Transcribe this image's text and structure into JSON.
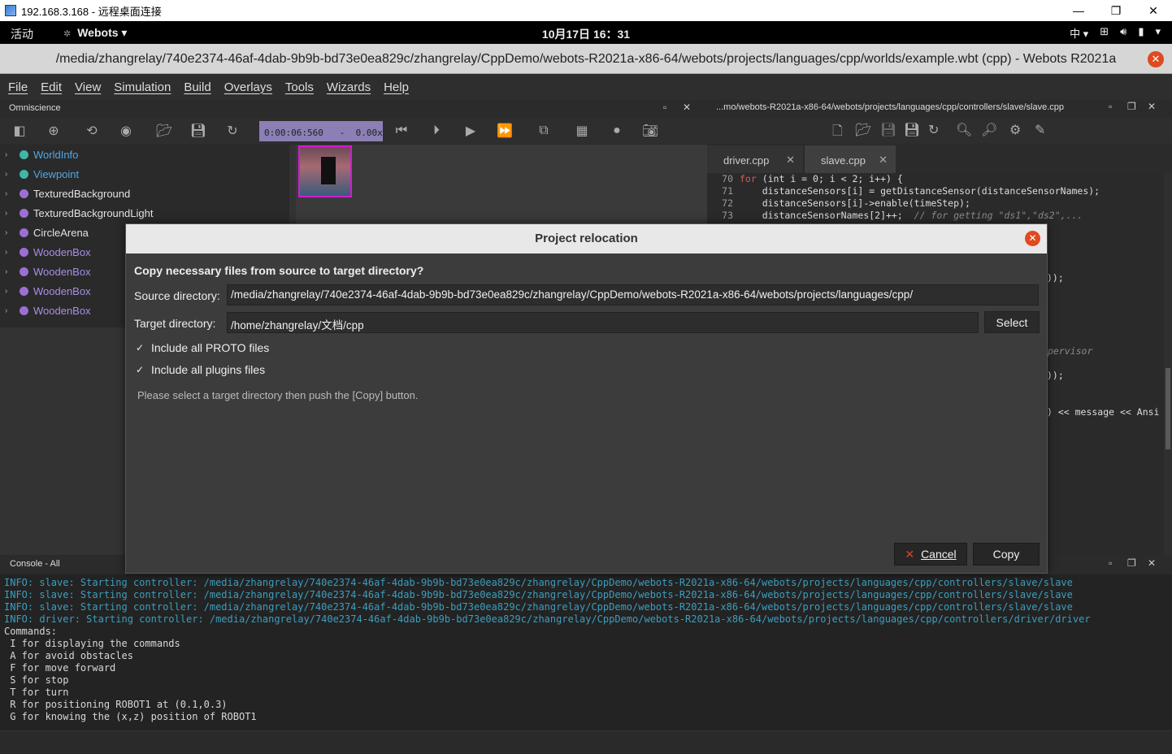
{
  "rdp": {
    "title": "192.168.3.168 - 远程桌面连接",
    "minimize": "—",
    "maximize": "❐",
    "close": "✕"
  },
  "gnome": {
    "activities": "活动",
    "app_menu": "Webots",
    "clock": "10月17日  16：31",
    "input_method": "中 ▾"
  },
  "window": {
    "title": "/media/zhangrelay/740e2374-46af-4dab-9b9b-bd73e0ea829c/zhangrelay/CppDemo/webots-R2021a-x86-64/webots/projects/languages/cpp/worlds/example.wbt (cpp) - Webots R2021a"
  },
  "menu": [
    "File",
    "Edit",
    "View",
    "Simulation",
    "Build",
    "Overlays",
    "Tools",
    "Wizards",
    "Help"
  ],
  "scene_panel": {
    "title": "Omniscience",
    "sim_time": "0:00:06:560   -  0.00x"
  },
  "tree": [
    {
      "label": "WorldInfo",
      "color": "teal"
    },
    {
      "label": "Viewpoint",
      "color": "teal"
    },
    {
      "label": "TexturedBackground",
      "color": "white"
    },
    {
      "label": "TexturedBackgroundLight",
      "color": "white"
    },
    {
      "label": "CircleArena",
      "color": "white"
    },
    {
      "label": "WoodenBox",
      "color": "purple"
    },
    {
      "label": "WoodenBox",
      "color": "purple"
    },
    {
      "label": "WoodenBox",
      "color": "purple"
    },
    {
      "label": "WoodenBox",
      "color": "purple"
    }
  ],
  "editor": {
    "path": "...mo/webots-R2021a-x86-64/webots/projects/languages/cpp/controllers/slave/slave.cpp",
    "tabs": [
      {
        "label": "driver.cpp"
      },
      {
        "label": "slave.cpp"
      }
    ],
    "lines": [
      {
        "num": "70",
        "pre": "  ",
        "kw": "for",
        "rest": " (int i = 0; i < 2; i++) {",
        "cm": ""
      },
      {
        "num": "71",
        "pre": "    distanceSensors[i] = getDistanceSensor(distanceSensorNames);",
        "kw": "",
        "rest": "",
        "cm": ""
      },
      {
        "num": "72",
        "pre": "    distanceSensors[i]->enable(timeStep);",
        "kw": "",
        "rest": "",
        "cm": ""
      },
      {
        "num": "73",
        "pre": "    distanceSensorNames[2]++;  ",
        "kw": "",
        "rest": "",
        "cm": "// for getting \"ds1\",\"ds2\",..."
      }
    ],
    "fragments": {
      "f1": "));",
      "f2": "pervisor",
      "f3": "));",
      "f4": ") << message << Ansi"
    }
  },
  "console": {
    "title": "Console - All",
    "lines": [
      {
        "type": "info",
        "text": "INFO: slave: Starting controller: /media/zhangrelay/740e2374-46af-4dab-9b9b-bd73e0ea829c/zhangrelay/CppDemo/webots-R2021a-x86-64/webots/projects/languages/cpp/controllers/slave/slave"
      },
      {
        "type": "info",
        "text": "INFO: slave: Starting controller: /media/zhangrelay/740e2374-46af-4dab-9b9b-bd73e0ea829c/zhangrelay/CppDemo/webots-R2021a-x86-64/webots/projects/languages/cpp/controllers/slave/slave"
      },
      {
        "type": "info",
        "text": "INFO: slave: Starting controller: /media/zhangrelay/740e2374-46af-4dab-9b9b-bd73e0ea829c/zhangrelay/CppDemo/webots-R2021a-x86-64/webots/projects/languages/cpp/controllers/slave/slave"
      },
      {
        "type": "info",
        "text": "INFO: driver: Starting controller: /media/zhangrelay/740e2374-46af-4dab-9b9b-bd73e0ea829c/zhangrelay/CppDemo/webots-R2021a-x86-64/webots/projects/languages/cpp/controllers/driver/driver"
      },
      {
        "type": "plain",
        "text": "Commands:"
      },
      {
        "type": "plain",
        "text": " I for displaying the commands"
      },
      {
        "type": "plain",
        "text": " A for avoid obstacles"
      },
      {
        "type": "plain",
        "text": " F for move forward"
      },
      {
        "type": "plain",
        "text": " S for stop"
      },
      {
        "type": "plain",
        "text": " T for turn"
      },
      {
        "type": "plain",
        "text": " R for positioning ROBOT1 at (0.1,0.3)"
      },
      {
        "type": "plain",
        "text": " G for knowing the (x,z) position of ROBOT1"
      }
    ]
  },
  "dialog": {
    "title": "Project relocation",
    "question": "Copy necessary files from source to target directory?",
    "source_label": "Source directory:",
    "source_value": "/media/zhangrelay/740e2374-46af-4dab-9b9b-bd73e0ea829c/zhangrelay/CppDemo/webots-R2021a-x86-64/webots/projects/languages/cpp/",
    "target_label": "Target directory:",
    "target_value": "/home/zhangrelay/文档/cpp",
    "select_label": "Select",
    "include_proto_label": "Include all PROTO files",
    "include_proto_checked": true,
    "include_plugins_label": "Include all plugins files",
    "include_plugins_checked": true,
    "hint": "Please select a target directory then push the [Copy] button.",
    "cancel_label": "Cancel",
    "copy_label": "Copy"
  }
}
